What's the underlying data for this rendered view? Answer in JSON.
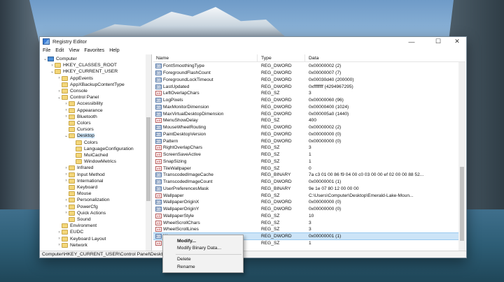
{
  "window": {
    "title": "Registry Editor",
    "controls": {
      "minimize": "—",
      "maximize": "☐",
      "close": "✕"
    }
  },
  "menu": [
    "File",
    "Edit",
    "View",
    "Favorites",
    "Help"
  ],
  "tree": [
    {
      "label": "Computer",
      "twisty": "⌄",
      "icon": "computer-icon",
      "depth": 0
    },
    {
      "label": "HKEY_CLASSES_ROOT",
      "twisty": "›",
      "icon": "folder-icon",
      "depth": 1
    },
    {
      "label": "HKEY_CURRENT_USER",
      "twisty": "⌄",
      "icon": "folder-icon",
      "depth": 1
    },
    {
      "label": "AppEvents",
      "twisty": "›",
      "icon": "folder-icon",
      "depth": 2
    },
    {
      "label": "AppXBackupContentType",
      "twisty": "",
      "icon": "folder-icon",
      "depth": 2
    },
    {
      "label": "Console",
      "twisty": "›",
      "icon": "folder-icon",
      "depth": 2
    },
    {
      "label": "Control Panel",
      "twisty": "⌄",
      "icon": "folder-icon",
      "depth": 2
    },
    {
      "label": "Accessibility",
      "twisty": "›",
      "icon": "folder-icon",
      "depth": 3
    },
    {
      "label": "Appearance",
      "twisty": "›",
      "icon": "folder-icon",
      "depth": 3
    },
    {
      "label": "Bluetooth",
      "twisty": "›",
      "icon": "folder-icon",
      "depth": 3
    },
    {
      "label": "Colors",
      "twisty": "",
      "icon": "folder-icon",
      "depth": 3
    },
    {
      "label": "Cursors",
      "twisty": "",
      "icon": "folder-icon",
      "depth": 3
    },
    {
      "label": "Desktop",
      "twisty": "⌄",
      "icon": "folder-icon",
      "depth": 3,
      "selected": true
    },
    {
      "label": "Colors",
      "twisty": "",
      "icon": "folder-icon",
      "depth": 4
    },
    {
      "label": "LanguageConfiguration",
      "twisty": "",
      "icon": "folder-icon",
      "depth": 4
    },
    {
      "label": "MuiCached",
      "twisty": "",
      "icon": "folder-icon",
      "depth": 4
    },
    {
      "label": "WindowMetrics",
      "twisty": "",
      "icon": "folder-icon",
      "depth": 4
    },
    {
      "label": "Infrared",
      "twisty": "›",
      "icon": "folder-icon",
      "depth": 3
    },
    {
      "label": "Input Method",
      "twisty": "›",
      "icon": "folder-icon",
      "depth": 3
    },
    {
      "label": "International",
      "twisty": "›",
      "icon": "folder-icon",
      "depth": 3
    },
    {
      "label": "Keyboard",
      "twisty": "",
      "icon": "folder-icon",
      "depth": 3
    },
    {
      "label": "Mouse",
      "twisty": "",
      "icon": "folder-icon",
      "depth": 3
    },
    {
      "label": "Personalization",
      "twisty": "›",
      "icon": "folder-icon",
      "depth": 3
    },
    {
      "label": "PowerCfg",
      "twisty": "›",
      "icon": "folder-icon",
      "depth": 3
    },
    {
      "label": "Quick Actions",
      "twisty": "›",
      "icon": "folder-icon",
      "depth": 3
    },
    {
      "label": "Sound",
      "twisty": "",
      "icon": "folder-icon",
      "depth": 3
    },
    {
      "label": "Environment",
      "twisty": "",
      "icon": "folder-icon",
      "depth": 2
    },
    {
      "label": "EUDC",
      "twisty": "›",
      "icon": "folder-icon",
      "depth": 2
    },
    {
      "label": "Keyboard Layout",
      "twisty": "›",
      "icon": "folder-icon",
      "depth": 2
    },
    {
      "label": "Network",
      "twisty": "›",
      "icon": "folder-icon",
      "depth": 2
    }
  ],
  "columns": {
    "name": "Name",
    "type": "Type",
    "data": "Data"
  },
  "values": [
    {
      "name": "FontSmoothingType",
      "type": "REG_DWORD",
      "data": "0x00000002 (2)",
      "kind": "bin"
    },
    {
      "name": "ForegroundFlashCount",
      "type": "REG_DWORD",
      "data": "0x00000007 (7)",
      "kind": "bin"
    },
    {
      "name": "ForegroundLockTimeout",
      "type": "REG_DWORD",
      "data": "0x00030d40 (200000)",
      "kind": "bin"
    },
    {
      "name": "LastUpdated",
      "type": "REG_DWORD",
      "data": "0xffffffff (4294967295)",
      "kind": "bin"
    },
    {
      "name": "LeftOverlapChars",
      "type": "REG_SZ",
      "data": "3",
      "kind": "sz"
    },
    {
      "name": "LogPixels",
      "type": "REG_DWORD",
      "data": "0x00000060 (96)",
      "kind": "bin"
    },
    {
      "name": "MaxMonitorDimension",
      "type": "REG_DWORD",
      "data": "0x00000400 (1024)",
      "kind": "bin"
    },
    {
      "name": "MaxVirtualDesktopDimension",
      "type": "REG_DWORD",
      "data": "0x000005a0 (1440)",
      "kind": "bin"
    },
    {
      "name": "MenuShowDelay",
      "type": "REG_SZ",
      "data": "400",
      "kind": "sz"
    },
    {
      "name": "MouseWheelRouting",
      "type": "REG_DWORD",
      "data": "0x00000002 (2)",
      "kind": "bin"
    },
    {
      "name": "PaintDesktopVersion",
      "type": "REG_DWORD",
      "data": "0x00000000 (0)",
      "kind": "bin"
    },
    {
      "name": "Pattern",
      "type": "REG_DWORD",
      "data": "0x00000000 (0)",
      "kind": "bin"
    },
    {
      "name": "RightOverlapChars",
      "type": "REG_SZ",
      "data": "3",
      "kind": "sz"
    },
    {
      "name": "ScreenSaveActive",
      "type": "REG_SZ",
      "data": "1",
      "kind": "sz"
    },
    {
      "name": "SnapSizing",
      "type": "REG_SZ",
      "data": "1",
      "kind": "sz"
    },
    {
      "name": "TileWallpaper",
      "type": "REG_SZ",
      "data": "0",
      "kind": "sz"
    },
    {
      "name": "TranscodedImageCache",
      "type": "REG_BINARY",
      "data": "7a c3 01 00 86 f9 04 00 c0 03 00 00 ef 02 00 00 88 52...",
      "kind": "bin"
    },
    {
      "name": "TranscodedImageCount",
      "type": "REG_DWORD",
      "data": "0x00000001 (1)",
      "kind": "bin"
    },
    {
      "name": "UserPreferencesMask",
      "type": "REG_BINARY",
      "data": "9e 1e 07 80 12 00 00 00",
      "kind": "bin"
    },
    {
      "name": "Wallpaper",
      "type": "REG_SZ",
      "data": "C:\\Users\\Computer\\Desktop\\Emerald-Lake-Moun...",
      "kind": "sz"
    },
    {
      "name": "WallpaperOriginX",
      "type": "REG_DWORD",
      "data": "0x00000000 (0)",
      "kind": "bin"
    },
    {
      "name": "WallpaperOriginY",
      "type": "REG_DWORD",
      "data": "0x00000000 (0)",
      "kind": "bin"
    },
    {
      "name": "WallpaperStyle",
      "type": "REG_SZ",
      "data": "10",
      "kind": "sz"
    },
    {
      "name": "WheelScrollChars",
      "type": "REG_SZ",
      "data": "3",
      "kind": "sz"
    },
    {
      "name": "WheelScrollLines",
      "type": "REG_SZ",
      "data": "3",
      "kind": "sz"
    },
    {
      "name": "W",
      "type": "REG_DWORD",
      "data": "0x00000001 (1)",
      "kind": "bin",
      "selected": true
    },
    {
      "name": "",
      "type": "REG_SZ",
      "data": "1",
      "kind": "sz"
    }
  ],
  "statusbar": "Computer\\HKEY_CURRENT_USER\\Control Panel\\Desktop",
  "context_menu": {
    "modify": "Modify...",
    "modify_binary": "Modify Binary Data...",
    "delete": "Delete",
    "rename": "Rename"
  }
}
